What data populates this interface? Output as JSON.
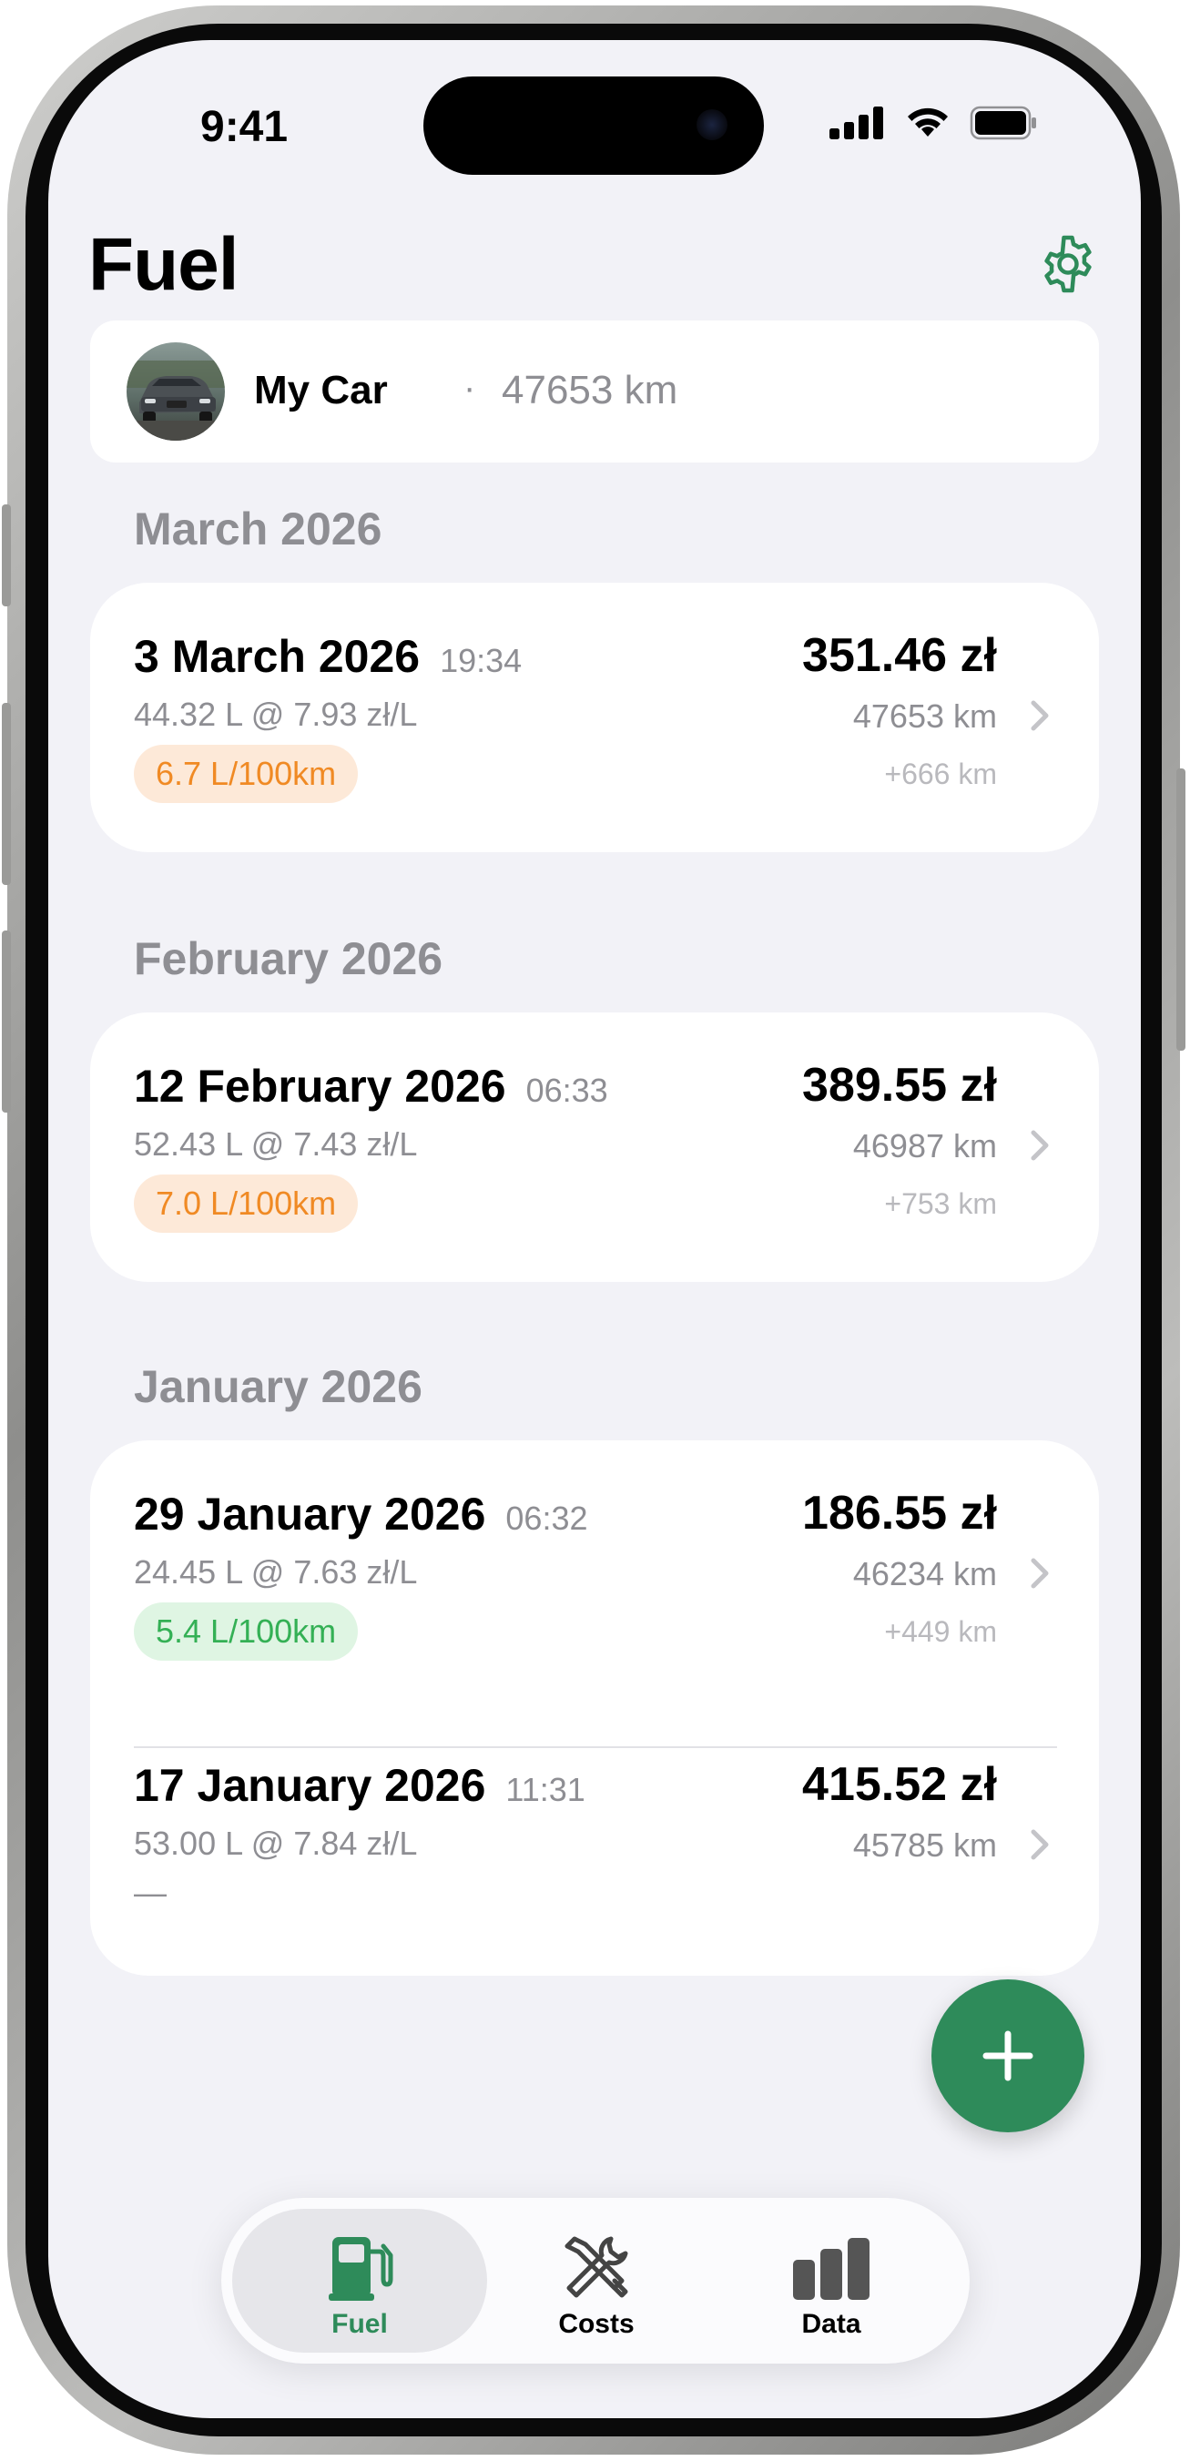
{
  "status_bar": {
    "time": "9:41"
  },
  "header": {
    "title": "Fuel",
    "settings_icon": "gear-icon"
  },
  "car": {
    "name": "My Car",
    "separator": "·",
    "odometer": "47653 km"
  },
  "months": [
    {
      "label": "March 2026",
      "entries": [
        {
          "date": "3 March 2026",
          "time": "19:34",
          "detail": "44.32 L @ 7.93 zł/L",
          "consumption": "6.7 L/100km",
          "consumption_tone": "orange",
          "price": "351.46 zł",
          "odometer": "47653 km",
          "delta": "+666 km"
        }
      ]
    },
    {
      "label": "February 2026",
      "entries": [
        {
          "date": "12 February 2026",
          "time": "06:33",
          "detail": "52.43 L @ 7.43 zł/L",
          "consumption": "7.0 L/100km",
          "consumption_tone": "orange",
          "price": "389.55 zł",
          "odometer": "46987 km",
          "delta": "+753 km"
        }
      ]
    },
    {
      "label": "January 2026",
      "entries": [
        {
          "date": "29 January 2026",
          "time": "06:32",
          "detail": "24.45 L @ 7.63 zł/L",
          "consumption": "5.4 L/100km",
          "consumption_tone": "green",
          "price": "186.55 zł",
          "odometer": "46234 km",
          "delta": "+449 km"
        },
        {
          "date": "17 January 2026",
          "time": "11:31",
          "detail": "53.00 L @ 7.84 zł/L",
          "consumption": "—",
          "consumption_tone": "none",
          "price": "415.52 zł",
          "odometer": "45785 km",
          "delta": ""
        }
      ]
    }
  ],
  "fab": {
    "icon": "plus-icon"
  },
  "tabs": [
    {
      "label": "Fuel",
      "icon": "fuel-pump-icon",
      "active": true,
      "color": "#2e8b5a"
    },
    {
      "label": "Costs",
      "icon": "tools-icon",
      "active": false,
      "color": "#000000"
    },
    {
      "label": "Data",
      "icon": "bar-chart-icon",
      "active": false,
      "color": "#000000"
    }
  ],
  "colors": {
    "accent": "#2e8b5a",
    "background": "#f2f2f7",
    "badge_orange_text": "#f08a24",
    "badge_orange_bg": "#fde9d8",
    "badge_green_text": "#34b055",
    "badge_green_bg": "#dff5e3"
  }
}
